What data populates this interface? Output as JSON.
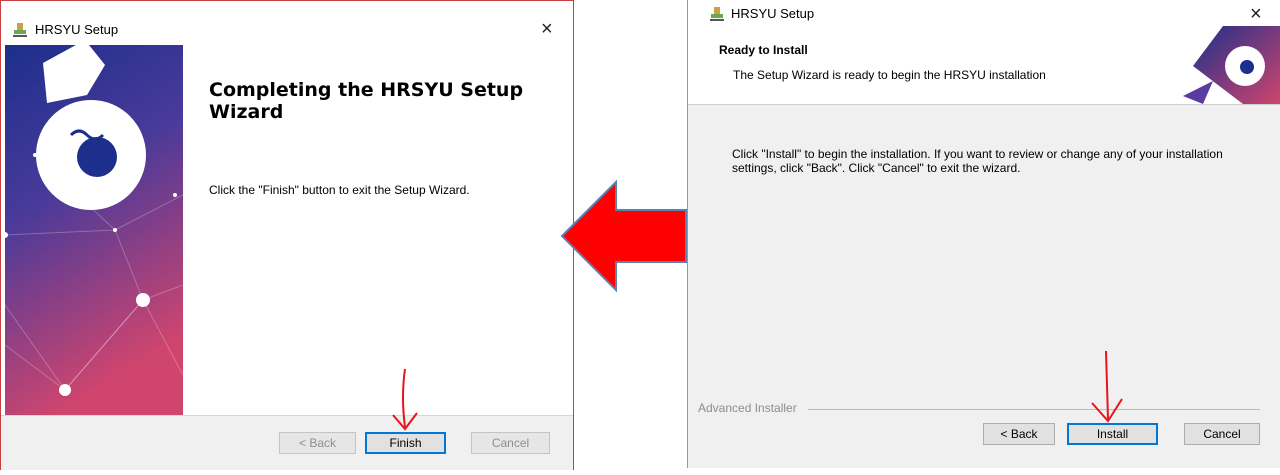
{
  "left_window": {
    "title": "HRSYU Setup",
    "heading": "Completing the HRSYU Setup Wizard",
    "body": "Click the \"Finish\" button to exit the Setup Wizard.",
    "buttons": {
      "back": "< Back",
      "finish": "Finish",
      "cancel": "Cancel"
    }
  },
  "right_window": {
    "title": "HRSYU Setup",
    "header_title": "Ready to Install",
    "header_subtitle": "The Setup Wizard is ready to begin the HRSYU installation",
    "body": "Click \"Install\" to begin the installation.  If you want to review or change any of your installation settings, click \"Back\".  Click \"Cancel\" to exit the wizard.",
    "brand_label": "Advanced Installer",
    "buttons": {
      "back": "< Back",
      "install": "Install",
      "cancel": "Cancel"
    }
  },
  "icons": {
    "close": "×",
    "app": "hrsyu-app-icon"
  },
  "colors": {
    "arrow": "#ff0000",
    "annotation": "#e8141c",
    "accent": "#0078d7",
    "banner_top": "#1c2f8c",
    "banner_bottom": "#d0456e"
  }
}
